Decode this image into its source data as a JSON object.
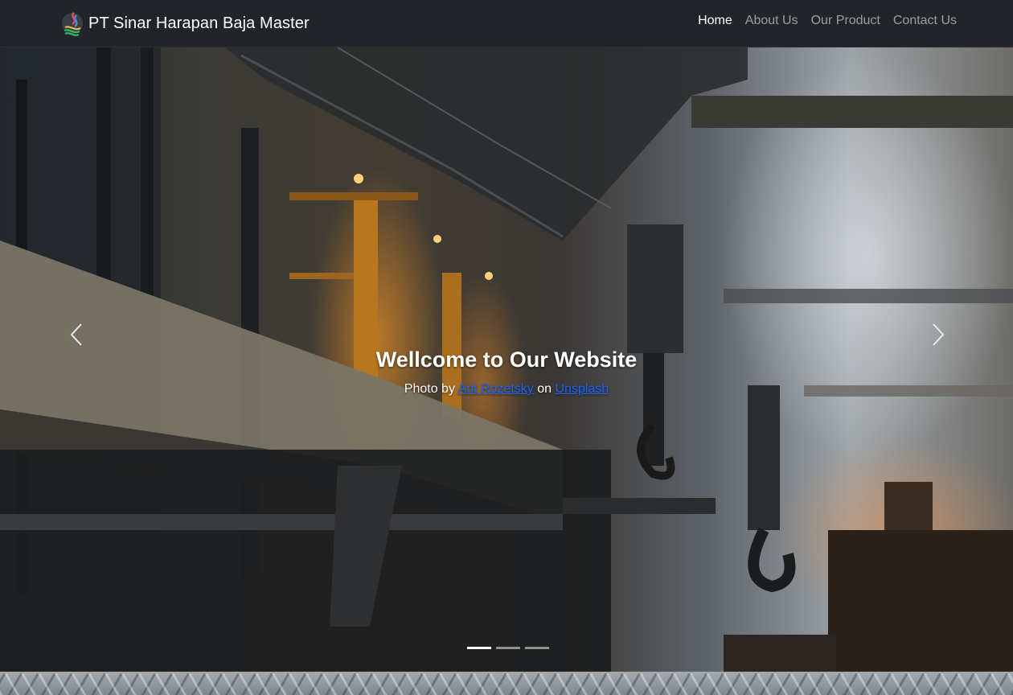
{
  "navbar": {
    "brand_name": "PT Sinar Harapan Baja Master",
    "brand_logo_icon": "steel-flame-logo-icon",
    "links": [
      {
        "label": "Home",
        "active": true
      },
      {
        "label": "About Us",
        "active": false
      },
      {
        "label": "Our Product",
        "active": false
      },
      {
        "label": "Contact Us",
        "active": false
      }
    ]
  },
  "carousel": {
    "caption_title": "Wellcome to Our Website",
    "credit_prefix": "Photo by",
    "photographer": "Ant Rozetsky",
    "credit_middle": "on",
    "site": "Unsplash",
    "prev_icon": "chevron-left-icon",
    "next_icon": "chevron-right-icon",
    "slide_count": 3,
    "active_slide": 1
  },
  "colors": {
    "navbar_bg": "#212529",
    "nav_active": "#ffffff",
    "nav_inactive": "rgba(255,255,255,0.55)",
    "link": "#1b66ff"
  }
}
